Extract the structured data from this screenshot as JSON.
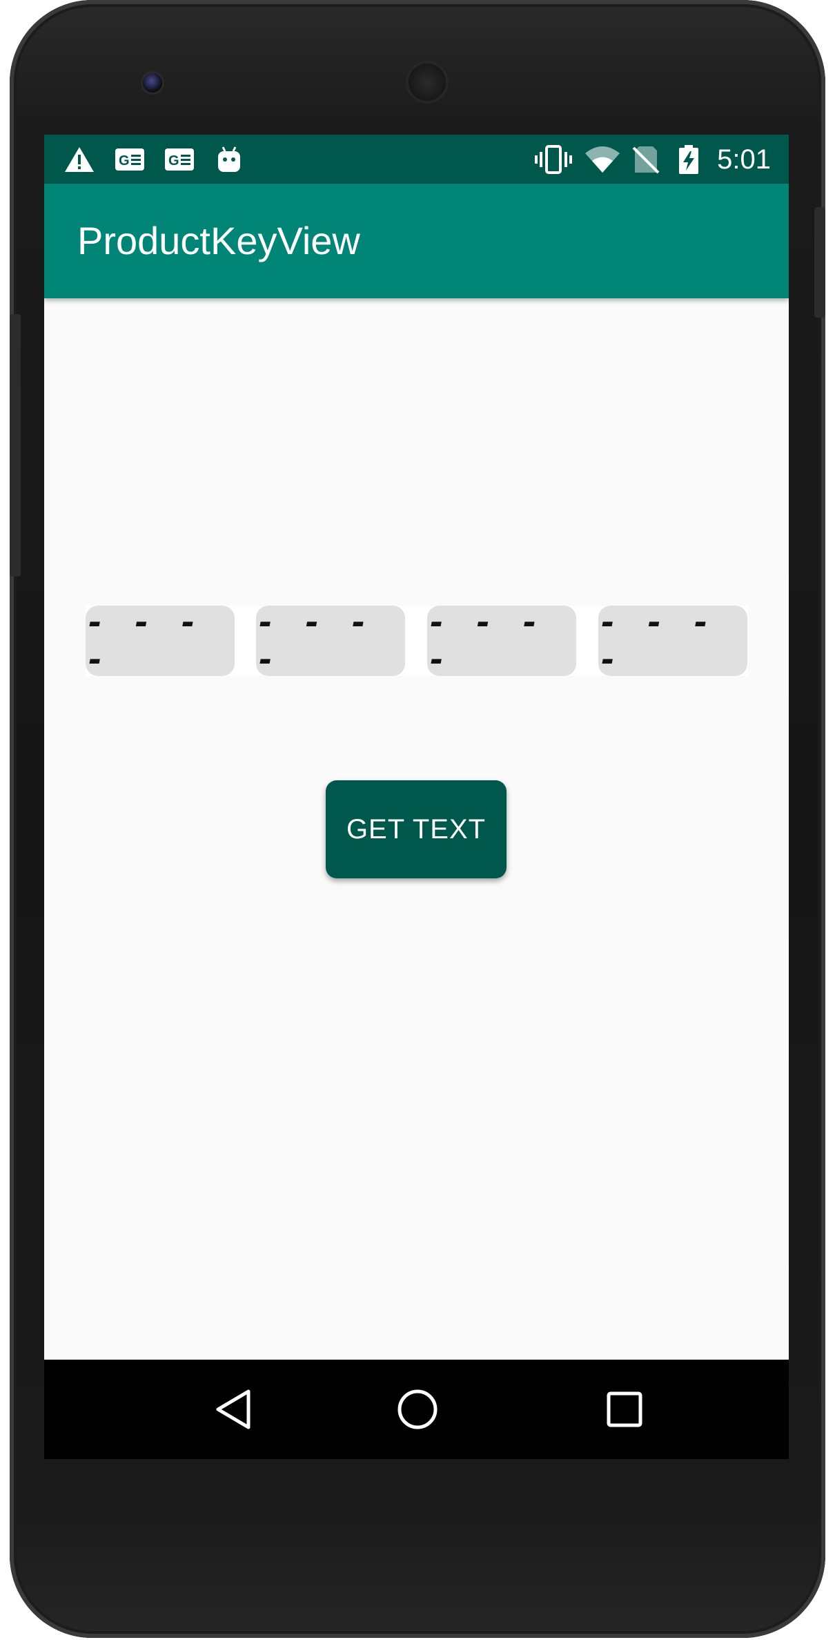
{
  "status_bar": {
    "time": "5:01",
    "left_icons": [
      "warning-icon",
      "contact-card-icon",
      "contact-card-icon",
      "android-icon"
    ],
    "right_icons": [
      "vibrate-icon",
      "wifi-icon",
      "no-sim-icon",
      "battery-charging-icon"
    ]
  },
  "app_bar": {
    "title": "ProductKeyView"
  },
  "product_key": {
    "segments": [
      {
        "placeholder": "- - - -"
      },
      {
        "placeholder": "- - - -"
      },
      {
        "placeholder": "- - - -"
      },
      {
        "placeholder": "- - - -"
      }
    ]
  },
  "actions": {
    "get_text_label": "GET TEXT"
  },
  "nav_bar": {
    "buttons": [
      "back-icon",
      "home-icon",
      "recents-icon"
    ]
  },
  "colors": {
    "status_bar": "#00574b",
    "app_bar": "#008577",
    "button": "#00574b",
    "key_box": "#e0e0e0",
    "background": "#fafafa"
  }
}
